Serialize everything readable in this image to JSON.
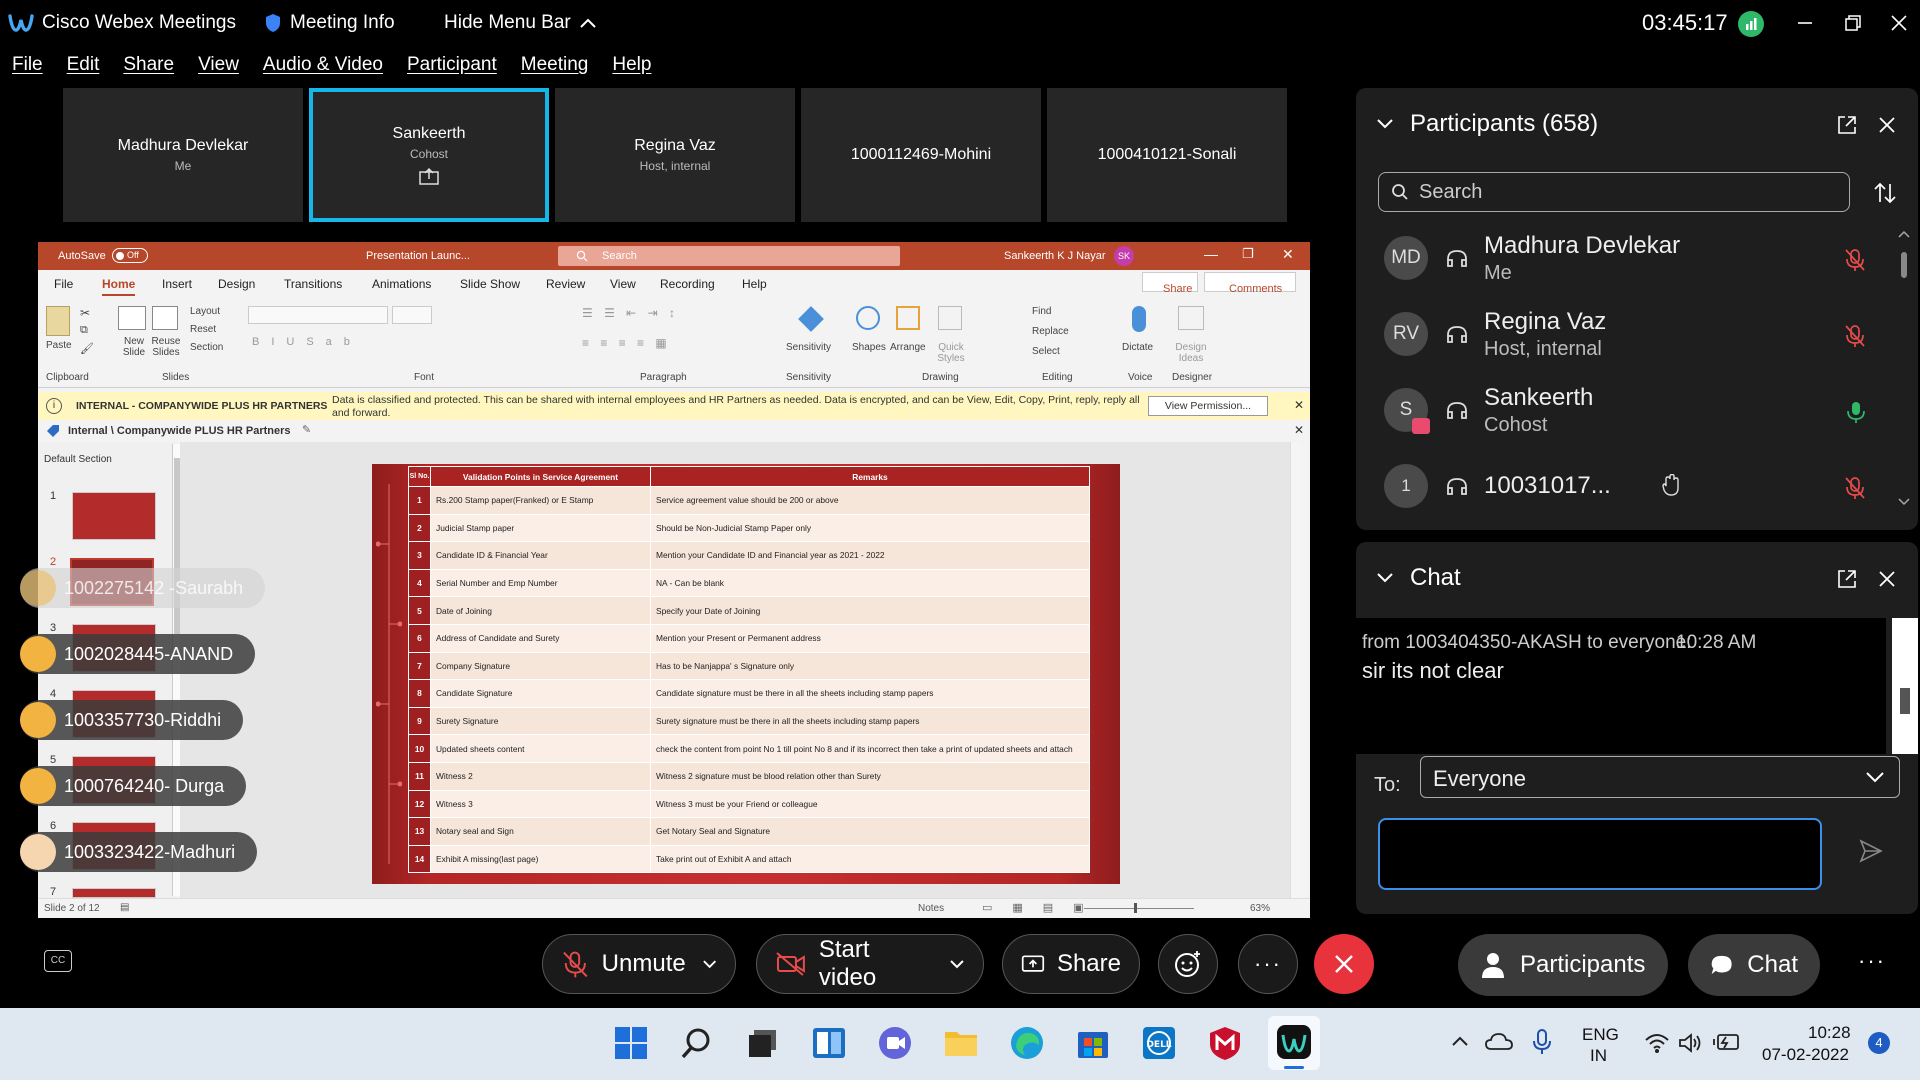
{
  "titlebar": {
    "app_name": "Cisco Webex Meetings",
    "meeting_info": "Meeting Info",
    "hide_menu": "Hide Menu Bar",
    "clock": "03:45:17"
  },
  "menu": [
    "File",
    "Edit",
    "Share",
    "View",
    "Audio & Video",
    "Participant",
    "Meeting",
    "Help"
  ],
  "video_tiles": [
    {
      "name": "Madhura Devlekar",
      "sub": "Me"
    },
    {
      "name": "Sankeerth",
      "sub": "Cohost"
    },
    {
      "name": "Regina Vaz",
      "sub": "Host, internal"
    },
    {
      "name": "1000112469-Mohini",
      "sub": ""
    },
    {
      "name": "1000410121-Sonali",
      "sub": ""
    }
  ],
  "participants": {
    "title": "Participants (658)",
    "search_placeholder": "Search",
    "list": [
      {
        "initials": "MD",
        "name": "Madhura Devlekar",
        "sub": "Me"
      },
      {
        "initials": "RV",
        "name": "Regina Vaz",
        "sub": "Host, internal"
      },
      {
        "initials": "S",
        "name": "Sankeerth",
        "sub": "Cohost"
      },
      {
        "initials": "1",
        "name": "10031017...",
        "sub": ""
      }
    ]
  },
  "chat": {
    "title": "Chat",
    "from": "from 1003404350-AKASH to everyone:",
    "time": "10:28 AM",
    "message": "sir its not clear",
    "to_label": "To:",
    "to_value": "Everyone"
  },
  "toolbar": {
    "unmute": "Unmute",
    "start_video": "Start video",
    "share": "Share",
    "participants": "Participants",
    "chat": "Chat"
  },
  "taskbar": {
    "lang_top": "ENG",
    "lang_bottom": "IN",
    "time": "10:28",
    "date": "07-02-2022",
    "notif_count": "4"
  },
  "ppt": {
    "autosave": "AutoSave",
    "autosave_state": "Off",
    "filename": "Presentation Launc...",
    "search": "Search",
    "user": "Sankeerth K J Nayar",
    "user_initials": "SK",
    "tabs": [
      "File",
      "Home",
      "Insert",
      "Design",
      "Transitions",
      "Animations",
      "Slide Show",
      "Review",
      "View",
      "Recording",
      "Help"
    ],
    "share_btn": "Share",
    "comments_btn": "Comments",
    "groups": [
      "Clipboard",
      "Slides",
      "Font",
      "Paragraph",
      "Sensitivity",
      "Drawing",
      "Editing",
      "Voice",
      "Designer"
    ],
    "ribbon_labels": {
      "paste": "Paste",
      "new_slide": "New Slide",
      "reuse_slides": "Reuse Slides",
      "layout": "Layout",
      "reset": "Reset",
      "section": "Section",
      "sensitivity": "Sensitivity",
      "shapes": "Shapes",
      "arrange": "Arrange",
      "quick_styles": "Quick Styles",
      "find": "Find",
      "replace": "Replace",
      "select": "Select",
      "dictate": "Dictate",
      "design_ideas": "Design Ideas"
    },
    "info_title": "INTERNAL - COMPANYWIDE PLUS HR PARTNERS",
    "info_text": "Data is classified and protected. This can be shared with internal employees and HR Partners as needed. Data is encrypted, and can be View, Edit, Copy, Print, reply, reply all and forward.",
    "view_permission": "View Permission...",
    "label": "Internal \\ Companywide PLUS HR Partners",
    "default_section": "Default Section",
    "slide_status": "Slide 2 of 12",
    "notes": "Notes",
    "zoom": "63%"
  },
  "slide_table": {
    "headers": [
      "Sl No.",
      "Validation Points in Service Agreement",
      "Remarks"
    ],
    "rows": [
      [
        "1",
        "Rs.200 Stamp paper(Franked) or E Stamp",
        "Service agreement value should be 200 or above"
      ],
      [
        "2",
        "Judicial Stamp paper",
        "Should be Non-Judicial Stamp Paper only"
      ],
      [
        "3",
        "Candidate ID & Financial Year",
        "Mention your Candidate ID and Financial year as 2021 - 2022"
      ],
      [
        "4",
        "Serial Number and Emp Number",
        "NA - Can be blank"
      ],
      [
        "5",
        "Date of Joining",
        "Specify your Date of Joining"
      ],
      [
        "6",
        "Address of Candidate and Surety",
        "Mention your Present or Permanent  address"
      ],
      [
        "7",
        "Company Signature",
        "Has to be Nanjappa' s Signature only"
      ],
      [
        "8",
        "Candidate Signature",
        "Candidate signature must be there in all the sheets including stamp papers"
      ],
      [
        "9",
        "Surety Signature",
        "Surety signature must be there in all the sheets including stamp papers"
      ],
      [
        "10",
        "Updated sheets content",
        "check the content from point No 1 till point No 8 and if its incorrect then take a print of updated sheets and attach"
      ],
      [
        "11",
        "Witness 2",
        "Witness 2 signature must be blood relation other than Surety"
      ],
      [
        "12",
        "Witness 3",
        "Witness 3 must be your Friend or colleague"
      ],
      [
        "13",
        "Notary seal and Sign",
        "Get Notary Seal and Signature"
      ],
      [
        "14",
        "Exhibit A missing(last page)",
        "Take print out of Exhibit A and attach"
      ]
    ]
  },
  "thumb_numbers": [
    "1",
    "2",
    "3",
    "4",
    "5",
    "6",
    "7"
  ],
  "reactions": [
    "1002275142 -Saurabh",
    "1002028445-ANAND",
    "1003357730-Riddhi",
    "1000764240- Durga",
    "1003323422-Madhuri"
  ]
}
